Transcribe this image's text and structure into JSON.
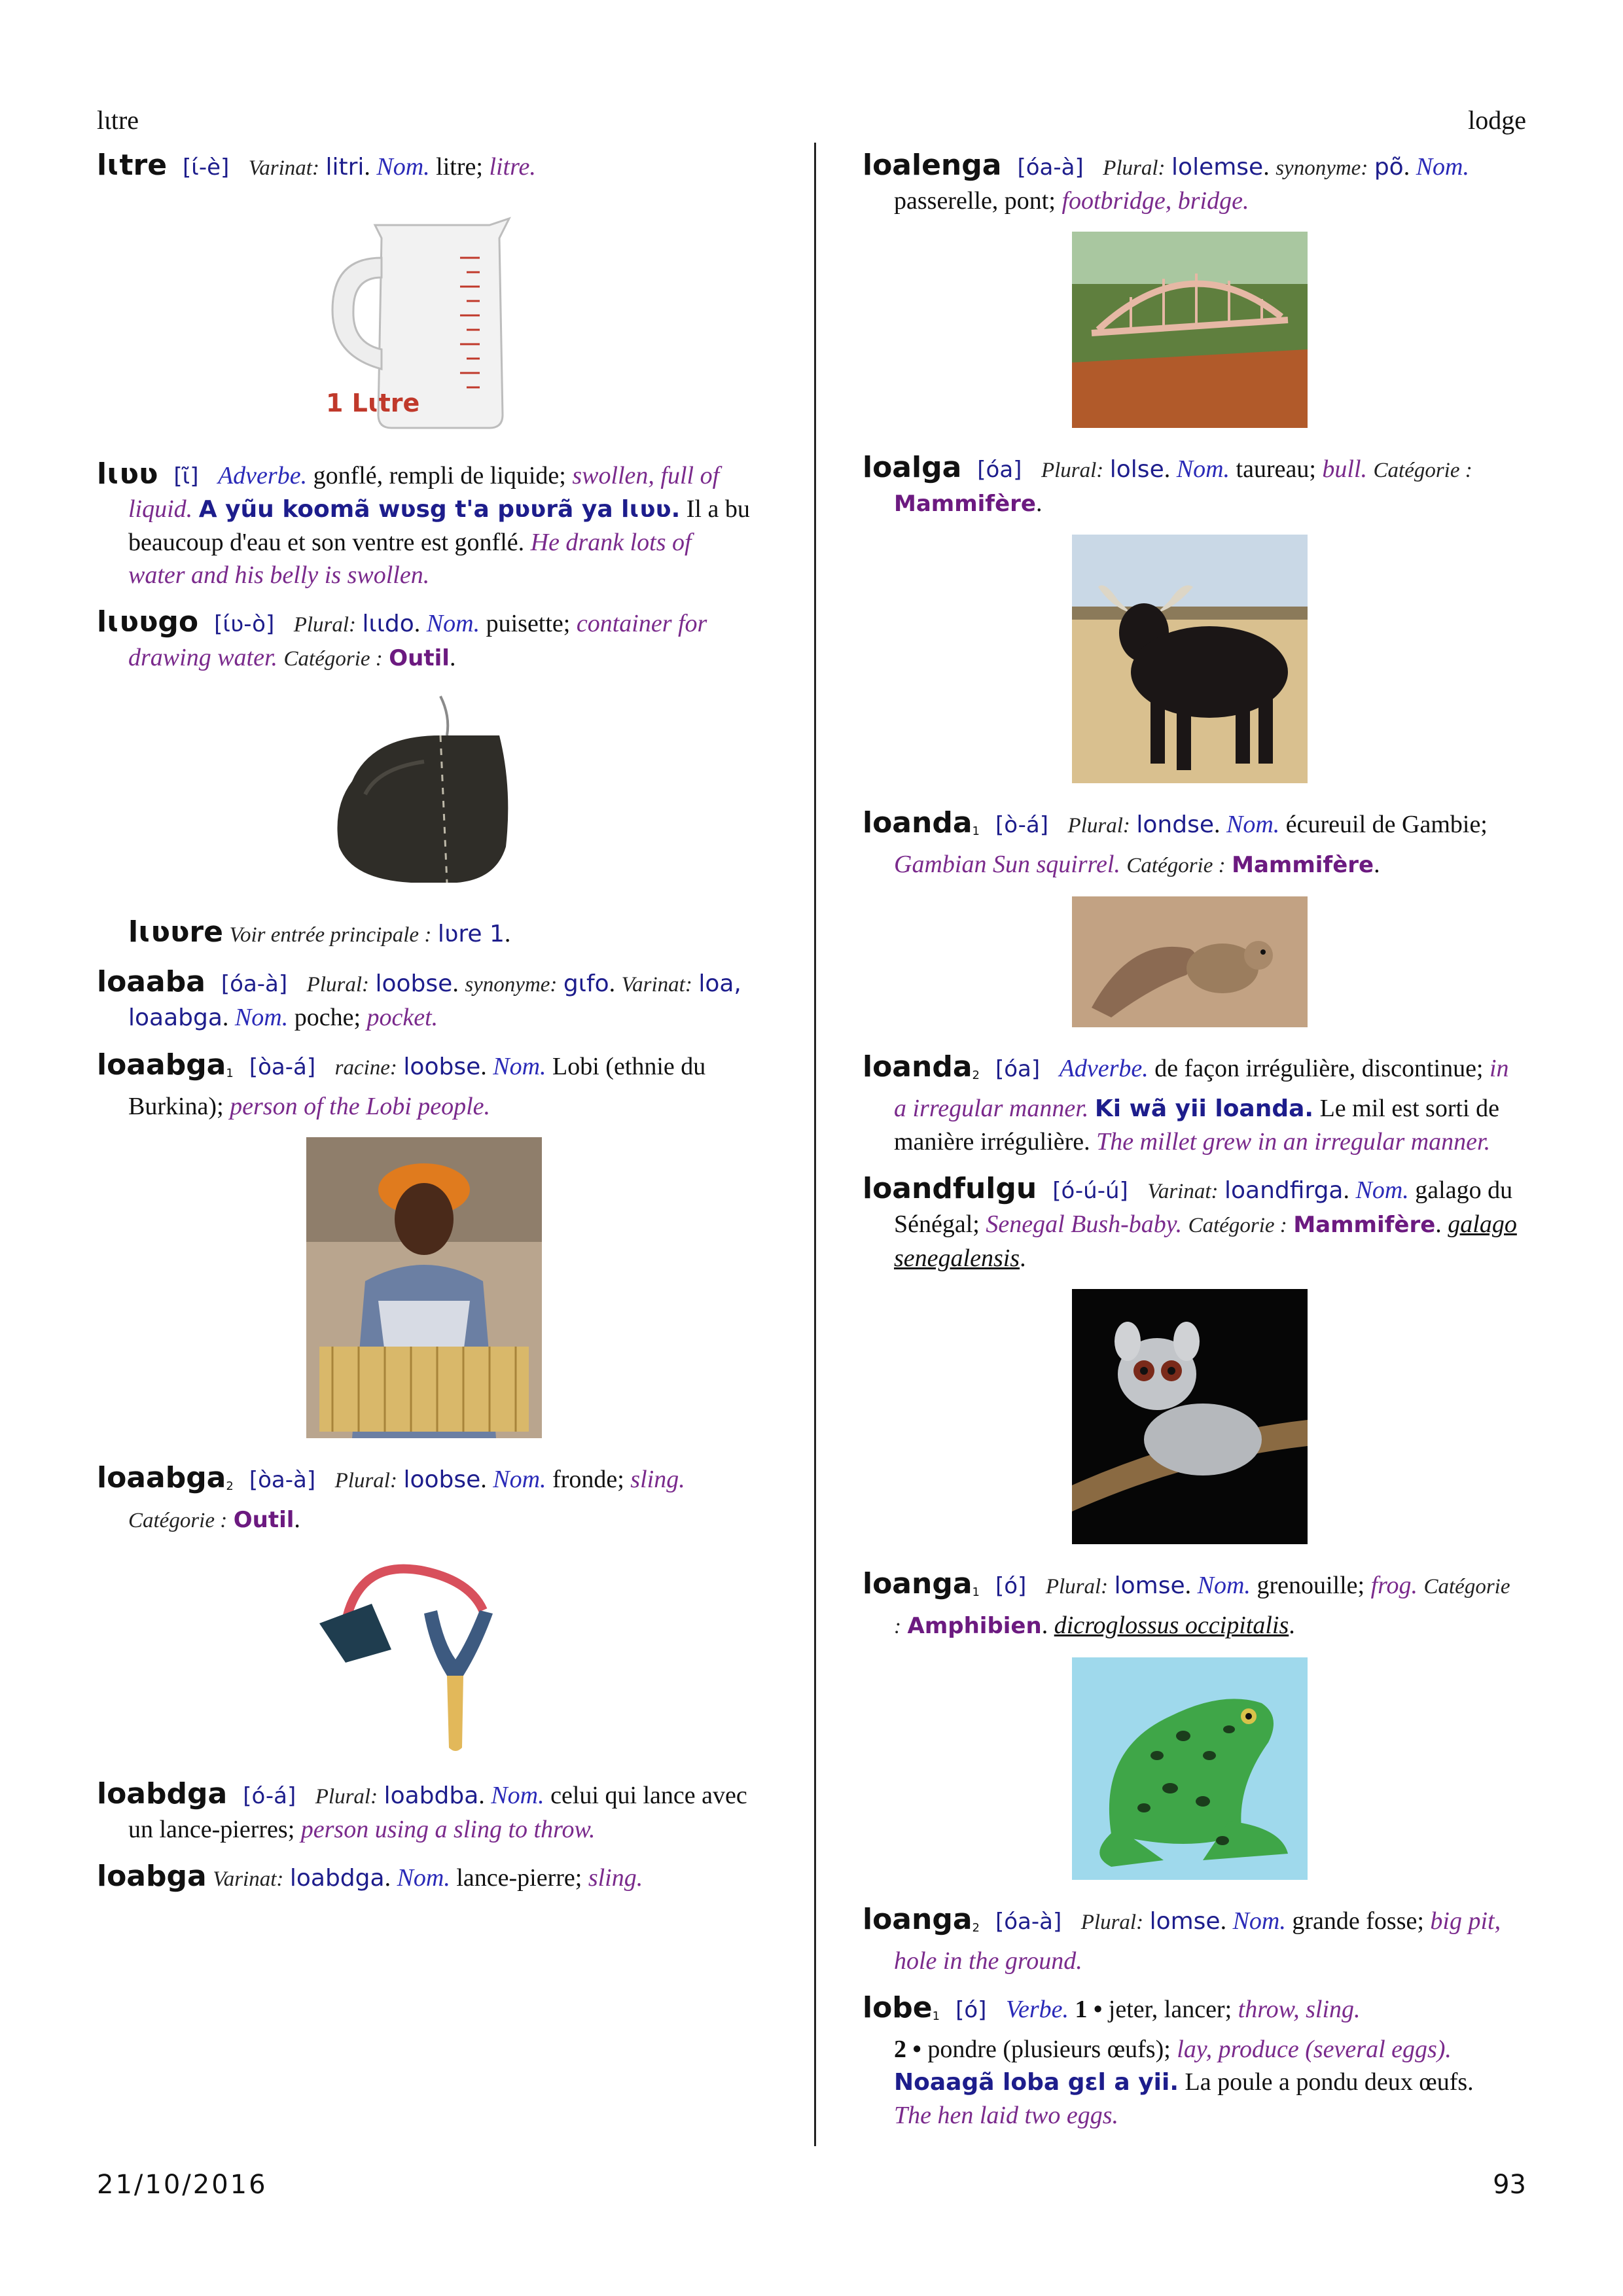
{
  "header": {
    "left": "lɩtre",
    "right": "lodge"
  },
  "footer": {
    "date": "21/10/2016",
    "page": "93"
  },
  "left_col": {
    "e1": {
      "hw": "lɩtre",
      "ph": "[ɩ́-è]",
      "var_label": "Varinat:",
      "var": "litri",
      "pos": "Nom.",
      "fr": "litre;",
      "en": "litre."
    },
    "e1_pic_text": "1 Lɩtre",
    "e2": {
      "hw": "lɩʋʋ",
      "ph": "[ɩ̃]",
      "pos": "Adverbe.",
      "fr": "gonflé, rempli de liquide;",
      "en": "swollen, full of liquid.",
      "ex": "A yũu koomã wʋsg t'a pʋʋrã ya lɩʋʋ.",
      "ex_fr": "Il a bu beaucoup d'eau et son ventre est gonflé.",
      "ex_en": "He drank lots of water and his belly is swollen."
    },
    "e3": {
      "hw": "lɩʋʋgo",
      "ph": "[ɩ́ʋ-ò]",
      "pl_label": "Plural:",
      "pl": "lɩɩdo",
      "pos": "Nom.",
      "fr": "puisette;",
      "en": "container for drawing water.",
      "cat_label": "Catégorie :",
      "cat": "Outil"
    },
    "e4": {
      "hw": "lɩʋʋre",
      "see": "Voir entrée principale :",
      "ref": "lʋre 1"
    },
    "e5": {
      "hw": "loaaba",
      "ph": "[óa-à]",
      "pl_label": "Plural:",
      "pl": "loobse",
      "syn_label": "synonyme:",
      "syn": "gɩfo",
      "var_label": "Varinat:",
      "var": "loa, loaabga",
      "pos": "Nom.",
      "fr": "poche;",
      "en": "pocket."
    },
    "e6": {
      "hw": "loaabga",
      "hom": "1",
      "ph": "[òa-á]",
      "root_label": "racine:",
      "root": "loobse",
      "pos": "Nom.",
      "fr": "Lobi (ethnie du Burkina);",
      "en": "person of the Lobi people."
    },
    "e7": {
      "hw": "loaabga",
      "hom": "2",
      "ph": "[òa-à]",
      "pl_label": "Plural:",
      "pl": "loobse",
      "pos": "Nom.",
      "fr": "fronde;",
      "en": "sling.",
      "cat_label": "Catégorie :",
      "cat": "Outil"
    },
    "e8": {
      "hw": "loabdga",
      "ph": "[ó-á]",
      "pl_label": "Plural:",
      "pl": "loabdba",
      "pos": "Nom.",
      "fr": "celui qui lance avec un lance-pierres;",
      "en": "person using a sling to throw."
    },
    "e9": {
      "hw": "loabga",
      "var_label": "Varinat:",
      "var": "loabdga",
      "pos": "Nom.",
      "fr": "lance-pierre;",
      "en": "sling."
    }
  },
  "right_col": {
    "e1": {
      "hw": "loalenga",
      "ph": "[óa-à]",
      "pl_label": "Plural:",
      "pl": "lolemse",
      "syn_label": "synonyme:",
      "syn": "põ",
      "pos": "Nom.",
      "fr": "passerelle, pont;",
      "en": "footbridge, bridge."
    },
    "e2": {
      "hw": "loalga",
      "ph": "[óa]",
      "pl_label": "Plural:",
      "pl": "lolse",
      "pos": "Nom.",
      "fr": "taureau;",
      "en": "bull.",
      "cat_label": "Catégorie :",
      "cat": "Mammifère"
    },
    "e3": {
      "hw": "loanda",
      "hom": "1",
      "ph": "[ò-á]",
      "pl_label": "Plural:",
      "pl": "londse",
      "pos": "Nom.",
      "fr": "écureuil de Gambie;",
      "en": "Gambian Sun squirrel.",
      "cat_label": "Catégorie :",
      "cat": "Mammifère"
    },
    "e4": {
      "hw": "loanda",
      "hom": "2",
      "ph": "[óa]",
      "pos": "Adverbe.",
      "fr": "de façon irrégulière, discontinue;",
      "en": "in a irregular manner.",
      "ex": "Ki wã yii loanda.",
      "ex_fr": "Le mil est sorti de manière irrégulière.",
      "ex_en": "The millet grew in an irregular manner."
    },
    "e5": {
      "hw": "loandfulgu",
      "ph": "[ó-ú-ú]",
      "var_label": "Varinat:",
      "var": "loandfirga",
      "pos": "Nom.",
      "fr": "galago du Sénégal;",
      "en": "Senegal Bush-baby.",
      "cat_label": "Catégorie :",
      "cat": "Mammifère",
      "sci": "galago senegalensis"
    },
    "e6": {
      "hw": "loanga",
      "hom": "1",
      "ph": "[ó]",
      "pl_label": "Plural:",
      "pl": "lomse",
      "pos": "Nom.",
      "fr": "grenouille;",
      "en": "frog.",
      "cat_label": "Catégorie :",
      "cat": "Amphibien",
      "sci": "dicroglossus occipitalis"
    },
    "e7": {
      "hw": "loanga",
      "hom": "2",
      "ph": "[óa-à]",
      "pl_label": "Plural:",
      "pl": "lomse",
      "pos": "Nom.",
      "fr": "grande fosse;",
      "en": "big pit, hole in the ground."
    },
    "e8": {
      "hw": "lobe",
      "hom": "1",
      "ph": "[ó]",
      "pos": "Verbe.",
      "s1_num": "1 •",
      "s1_fr": "jeter, lancer;",
      "s1_en": "throw, sling.",
      "s2_num": "2 •",
      "s2_fr": "pondre (plusieurs œufs);",
      "s2_en": "lay, produce (several eggs).",
      "ex": "Noaagã loba gɛl a yii.",
      "ex_fr": "La poule a pondu deux œufs.",
      "ex_en": "The hen laid two eggs."
    }
  }
}
